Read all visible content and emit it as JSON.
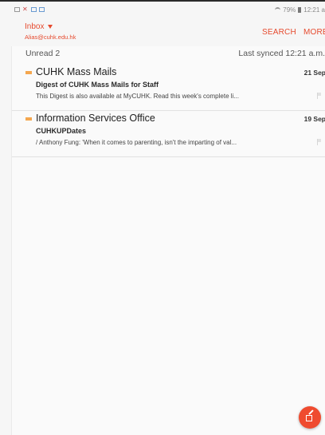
{
  "status_bar": {
    "notification_icons": [
      "image-icon",
      "missed-call-icon",
      "sms-icon",
      "email-icon"
    ],
    "wifi_icon": "wifi-icon",
    "battery_text": "79%",
    "battery_icon": "battery-icon",
    "time": "12:21 a"
  },
  "header": {
    "folder": "Inbox",
    "folder_caret_icon": "caret-down-icon",
    "account": "Alias@cuhk.edu.hk",
    "search_label": "SEARCH",
    "more_label": "MORE"
  },
  "sync": {
    "unread_label": "Unread 2",
    "last_synced": "Last synced  12:21 a.m."
  },
  "messages": [
    {
      "sender": "CUHK Mass Mails",
      "date": "21 Sep",
      "subject": "Digest of CUHK Mass Mails for Staff",
      "preview": "This Digest is also available at MyCUHK. Read this week's complete li...",
      "unread_marker_color": "#f4a74f"
    },
    {
      "sender": "Information Services Office",
      "date": "19 Sep",
      "subject": "CUHKUPDates",
      "preview": "/ Anthony Fung: 'When it comes to parenting, isn't the imparting of val...",
      "unread_marker_color": "#f4a74f"
    }
  ],
  "compose": {
    "icon": "compose-icon"
  },
  "colors": {
    "accent": "#e64a2e",
    "fab": "#ef4b2f",
    "unread_marker": "#f4a74f"
  }
}
